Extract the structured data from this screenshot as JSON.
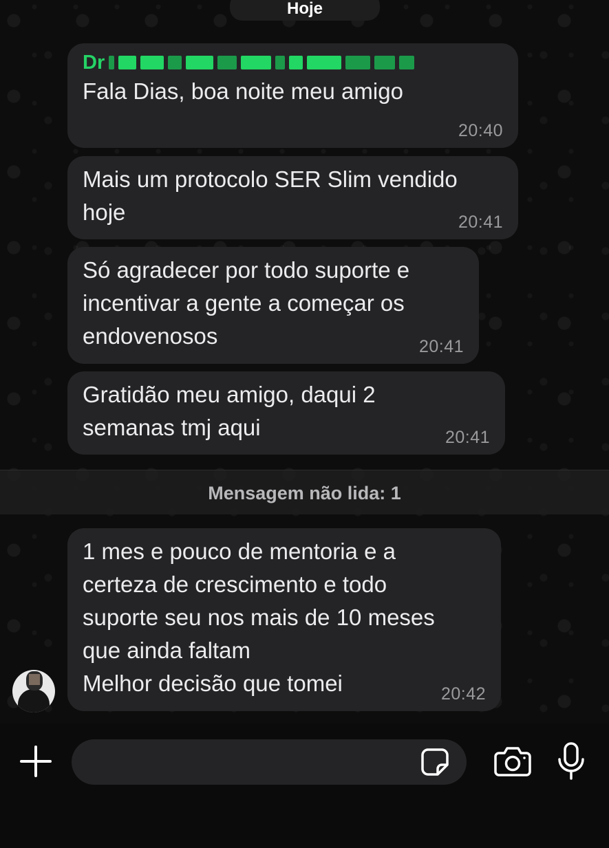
{
  "date_separator": "Hoje",
  "messages": [
    {
      "sender": "Dr",
      "text": "Fala Dias, boa noite meu amigo",
      "time": "20:40"
    },
    {
      "text": "Mais um protocolo SER Slim vendido\nhoje",
      "time": "20:41"
    },
    {
      "text": "Só agradecer por todo suporte e\nincentivar a gente a começar os\nendovenosos",
      "time": "20:41"
    },
    {
      "text": "Gratidão meu amigo, daqui 2\nsemanas tmj aqui",
      "time": "20:41"
    },
    {
      "text": "1 mes e pouco de mentoria e a\ncerteza de crescimento e todo\nsuporte seu nos mais de 10 meses\nque ainda faltam\nMelhor decisão que tomei",
      "time": "20:42"
    }
  ],
  "unread_banner": "Mensagem não lida: 1",
  "composer": {
    "placeholder": "",
    "icons": [
      "plus-icon",
      "sticker-icon",
      "camera-icon",
      "microphone-icon"
    ]
  },
  "colors": {
    "sender_name": "#25d366",
    "bubble": "#242426",
    "background": "#0b0b0b"
  }
}
